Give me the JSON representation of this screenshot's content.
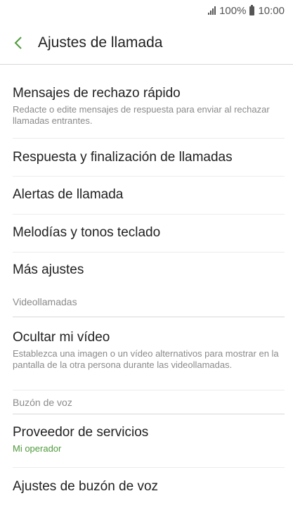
{
  "status_bar": {
    "battery": "100%",
    "time": "10:00"
  },
  "header": {
    "title": "Ajustes de llamada",
    "back_icon": "chevron-left-icon",
    "accent": "#4e9a3a"
  },
  "items": {
    "quick_decline": {
      "title": "Mensajes de rechazo rápido",
      "subtitle": "Redacte o edite mensajes de respuesta para enviar al rechazar llamadas entrantes."
    },
    "answer_end": {
      "title": "Respuesta y finalización de llamadas"
    },
    "call_alerts": {
      "title": "Alertas de llamada"
    },
    "ringtones": {
      "title": "Melodías y tonos teclado"
    },
    "more_settings": {
      "title": "Más ajustes"
    },
    "hide_video": {
      "title": "Ocultar mi vídeo",
      "subtitle": "Establezca una imagen o un vídeo alternativos para mostrar en la pantalla de la otra persona durante las videollamadas."
    },
    "service_provider": {
      "title": "Proveedor de servicios",
      "subtitle": "Mi operador"
    },
    "voicemail_settings": {
      "title": "Ajustes de buzón de voz"
    }
  },
  "sections": {
    "video_calls": "Videollamadas",
    "voicemail": "Buzón de voz"
  }
}
